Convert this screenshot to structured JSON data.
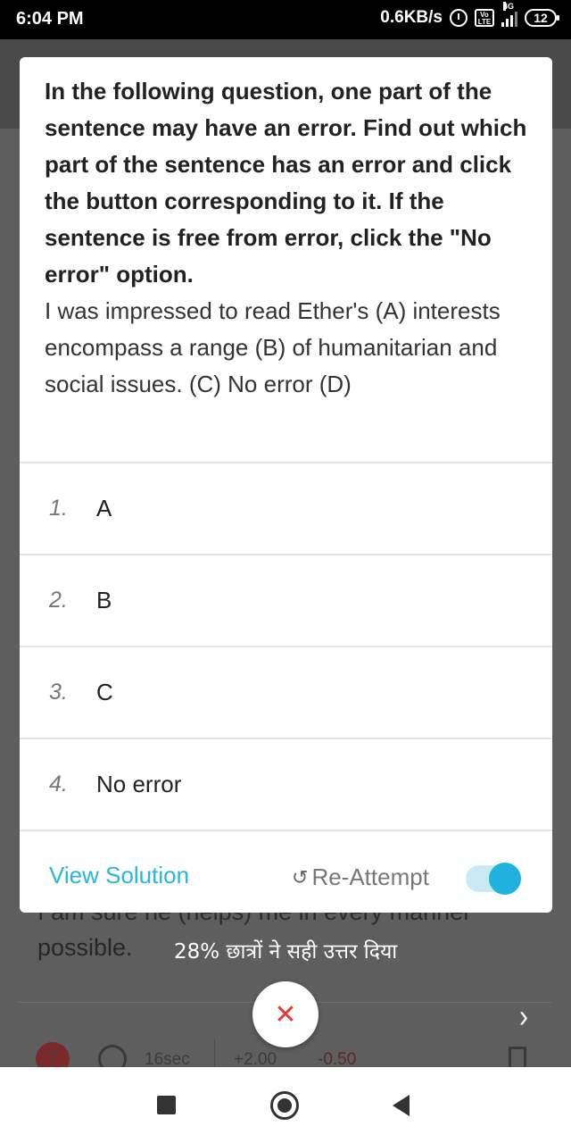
{
  "status_bar": {
    "time": "6:04 PM",
    "network_speed": "0.6KB/s",
    "network_type": "4G",
    "volte": "Vo LTE",
    "battery": "12",
    "icons": [
      "alarm-icon",
      "volte-icon",
      "signal-icon",
      "battery-icon"
    ]
  },
  "dialog": {
    "instruction": "In the following question, one part of the sentence may have an error. Find out which part of the sentence has an error and click the button corresponding to it. If the sentence is free from error, click the \"No error\" option.",
    "sentence": "I was impressed to read Ether's (A) interests encompass a range (B) of humanitarian and social issues. (C) No error (D)",
    "options": [
      {
        "number": "1.",
        "label": "A"
      },
      {
        "number": "2.",
        "label": "B"
      },
      {
        "number": "3.",
        "label": "C"
      },
      {
        "number": "4.",
        "label": "No error"
      }
    ],
    "view_solution_label": "View Solution",
    "reattempt_label": "Re-Attempt",
    "toggle_on": true
  },
  "background": {
    "partial_text_line1": "I am sure he (helps) me in every manner",
    "partial_text_line2": "possible.",
    "stat_text": "28% छात्रों ने सही उत्तर दिया",
    "question_number": "7",
    "time_taken": "16sec",
    "positive_marks": "+2.00",
    "negative_marks": "-0.50"
  },
  "colors": {
    "accent": "#29b6d8",
    "toggle_knob": "#1fb2dc",
    "close": "#e53935"
  }
}
